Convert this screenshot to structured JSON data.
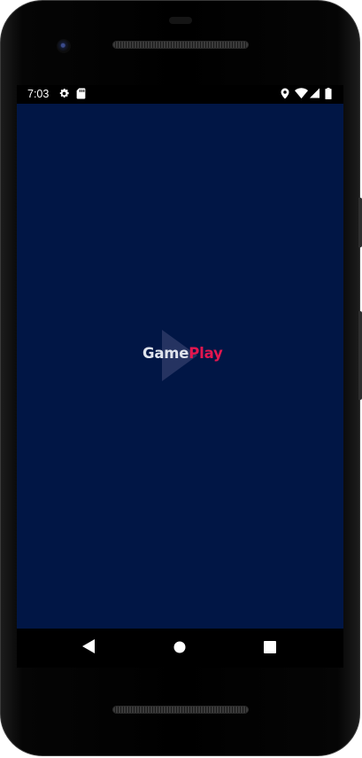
{
  "status_bar": {
    "time": "7:03",
    "left_icons": [
      "settings-icon",
      "sd-card-icon"
    ],
    "right_icons": [
      "location-icon",
      "wifi-icon",
      "signal-icon",
      "battery-icon"
    ]
  },
  "app": {
    "background": "#011645",
    "logo": {
      "text_part1": "Game",
      "text_part2": "Play",
      "color_part1": "#dfe3ec",
      "color_part2": "#e3164f",
      "mark": "play-triangle"
    }
  },
  "nav_bar": {
    "buttons": [
      "back-button",
      "home-button",
      "recents-button"
    ]
  }
}
